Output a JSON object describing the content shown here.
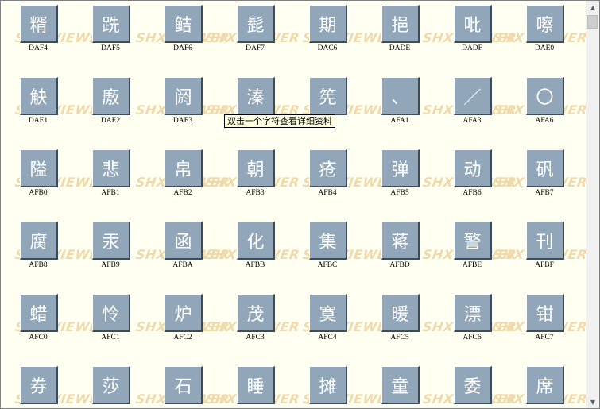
{
  "watermark": "SHX VIEWER",
  "tooltip": "双击一个字符查看详细资料",
  "rows": [
    {
      "cells": [
        {
          "char": "糈",
          "code": "DAF4"
        },
        {
          "char": "跣",
          "code": "DAF5"
        },
        {
          "char": "鲒",
          "code": "DAF6"
        },
        {
          "char": "髭",
          "code": "DAF7"
        },
        {
          "char": "期",
          "code": "DAC6"
        },
        {
          "char": "挹",
          "code": "DADE"
        },
        {
          "char": "吡",
          "code": "DADF"
        },
        {
          "char": "嚓",
          "code": "DAE0"
        }
      ]
    },
    {
      "cells": [
        {
          "char": "觖",
          "code": "DAE1"
        },
        {
          "char": "廒",
          "code": "DAE2"
        },
        {
          "char": "阏",
          "code": "DAE3"
        },
        {
          "char": "溱",
          "code": ""
        },
        {
          "char": "筅",
          "code": ""
        },
        {
          "char": "、",
          "code": "AFA1"
        },
        {
          "char": "／",
          "code": "AFA3"
        },
        {
          "char": "〇",
          "code": "AFA6"
        }
      ]
    },
    {
      "cells": [
        {
          "char": "隘",
          "code": "AFB0"
        },
        {
          "char": "悲",
          "code": "AFB1"
        },
        {
          "char": "帛",
          "code": "AFB2"
        },
        {
          "char": "朝",
          "code": "AFB3"
        },
        {
          "char": "疮",
          "code": "AFB4"
        },
        {
          "char": "弹",
          "code": "AFB5"
        },
        {
          "char": "动",
          "code": "AFB6"
        },
        {
          "char": "矾",
          "code": "AFB7"
        }
      ]
    },
    {
      "cells": [
        {
          "char": "腐",
          "code": "AFB8"
        },
        {
          "char": "汞",
          "code": "AFB9"
        },
        {
          "char": "函",
          "code": "AFBA"
        },
        {
          "char": "化",
          "code": "AFBB"
        },
        {
          "char": "集",
          "code": "AFBC"
        },
        {
          "char": "蒋",
          "code": "AFBD"
        },
        {
          "char": "警",
          "code": "AFBE"
        },
        {
          "char": "刊",
          "code": "AFBF"
        }
      ]
    },
    {
      "cells": [
        {
          "char": "蜡",
          "code": "AFC0"
        },
        {
          "char": "怜",
          "code": "AFC1"
        },
        {
          "char": "炉",
          "code": "AFC2"
        },
        {
          "char": "茂",
          "code": "AFC3"
        },
        {
          "char": "寞",
          "code": "AFC4"
        },
        {
          "char": "暖",
          "code": "AFC5"
        },
        {
          "char": "漂",
          "code": "AFC6"
        },
        {
          "char": "钳",
          "code": "AFC7"
        }
      ]
    },
    {
      "cells": [
        {
          "char": "券",
          "code": ""
        },
        {
          "char": "莎",
          "code": ""
        },
        {
          "char": "石",
          "code": ""
        },
        {
          "char": "睡",
          "code": ""
        },
        {
          "char": "摊",
          "code": ""
        },
        {
          "char": "童",
          "code": ""
        },
        {
          "char": "委",
          "code": ""
        },
        {
          "char": "席",
          "code": ""
        }
      ]
    }
  ],
  "scrollbar": {
    "up_arrow": "▲",
    "down_arrow": "▼"
  }
}
